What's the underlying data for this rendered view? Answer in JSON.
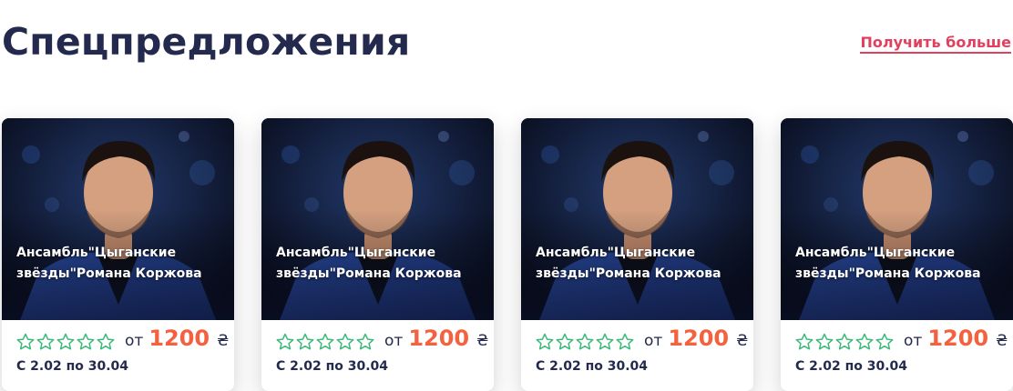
{
  "header": {
    "title": "Спецпредложения",
    "more_link": "Получить больше"
  },
  "colors": {
    "title": "#232a4e",
    "accent_link": "#e2405f",
    "price": "#f4613f",
    "star_outline": "#3dba7a"
  },
  "cards": [
    {
      "title_line1": "Ансамбль\"Цыганские",
      "title_line2": "звёзды\"Романа Коржова",
      "rating_stars": 0,
      "rating_max": 5,
      "price_from": "от",
      "price": "1200",
      "currency": "₴",
      "dates": "С 2.02 по 30.04"
    },
    {
      "title_line1": "Ансамбль\"Цыганские",
      "title_line2": "звёзды\"Романа Коржова",
      "rating_stars": 0,
      "rating_max": 5,
      "price_from": "от",
      "price": "1200",
      "currency": "₴",
      "dates": "С 2.02 по 30.04"
    },
    {
      "title_line1": "Ансамбль\"Цыганские",
      "title_line2": "звёзды\"Романа Коржова",
      "rating_stars": 0,
      "rating_max": 5,
      "price_from": "от",
      "price": "1200",
      "currency": "₴",
      "dates": "С 2.02 по 30.04"
    },
    {
      "title_line1": "Ансамбль\"Цыганские",
      "title_line2": "звёзды\"Романа Коржова",
      "rating_stars": 0,
      "rating_max": 5,
      "price_from": "от",
      "price": "1200",
      "currency": "₴",
      "dates": "С 2.02 по 30.04"
    }
  ]
}
